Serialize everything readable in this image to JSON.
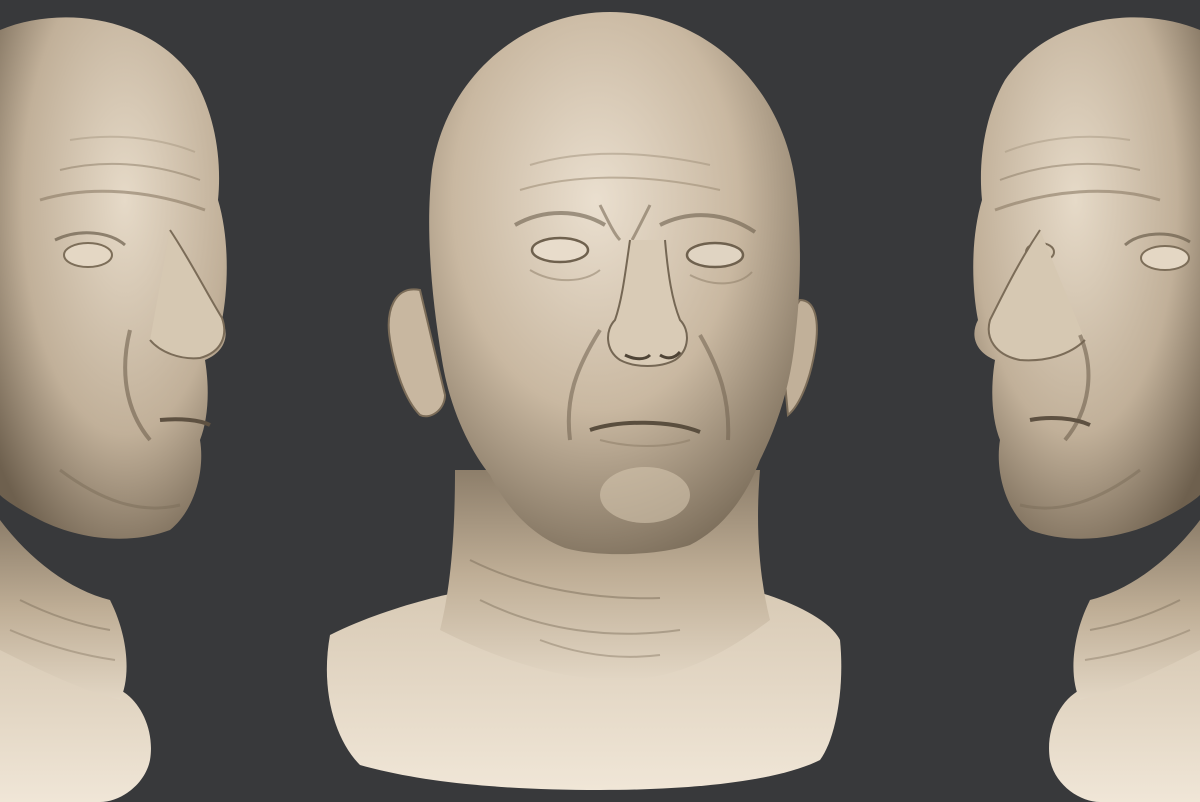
{
  "scene": {
    "background_color": "#38393b",
    "clay_light": "#e8dccb",
    "clay_mid": "#c4b39c",
    "clay_shadow": "#6f624f",
    "views": [
      {
        "name": "side-view-left",
        "facing": "right"
      },
      {
        "name": "front-view",
        "facing": "viewer"
      },
      {
        "name": "side-view-right",
        "facing": "left"
      }
    ]
  }
}
